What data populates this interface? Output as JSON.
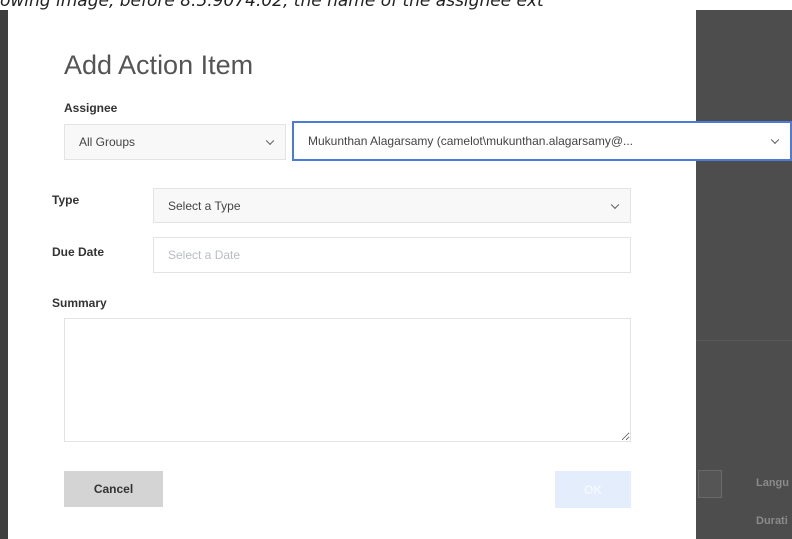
{
  "caption": "owing image, before 8.5.9074.02, the name of the assignee ext",
  "dialog": {
    "title": "Add Action Item",
    "assignee": {
      "label": "Assignee",
      "group_value": "All Groups",
      "person_value": "Mukunthan Alagarsamy (camelot\\mukunthan.alagarsamy@..."
    },
    "type": {
      "label": "Type",
      "value": "Select a Type"
    },
    "due_date": {
      "label": "Due Date",
      "placeholder": "Select a Date"
    },
    "summary": {
      "label": "Summary"
    },
    "buttons": {
      "cancel": "Cancel",
      "ok": "OK"
    }
  },
  "background": {
    "language_label": "Langu",
    "duration_label": "Durati"
  },
  "colors": {
    "overlay": "#4d4d4d",
    "focus_border": "#4a7bd6",
    "ok_button": "#e3edfb",
    "cancel_button": "#d4d4d4"
  },
  "icons": {
    "select_arrow": "chevron-down-icon",
    "textarea_resize": "resize-handle-icon"
  }
}
